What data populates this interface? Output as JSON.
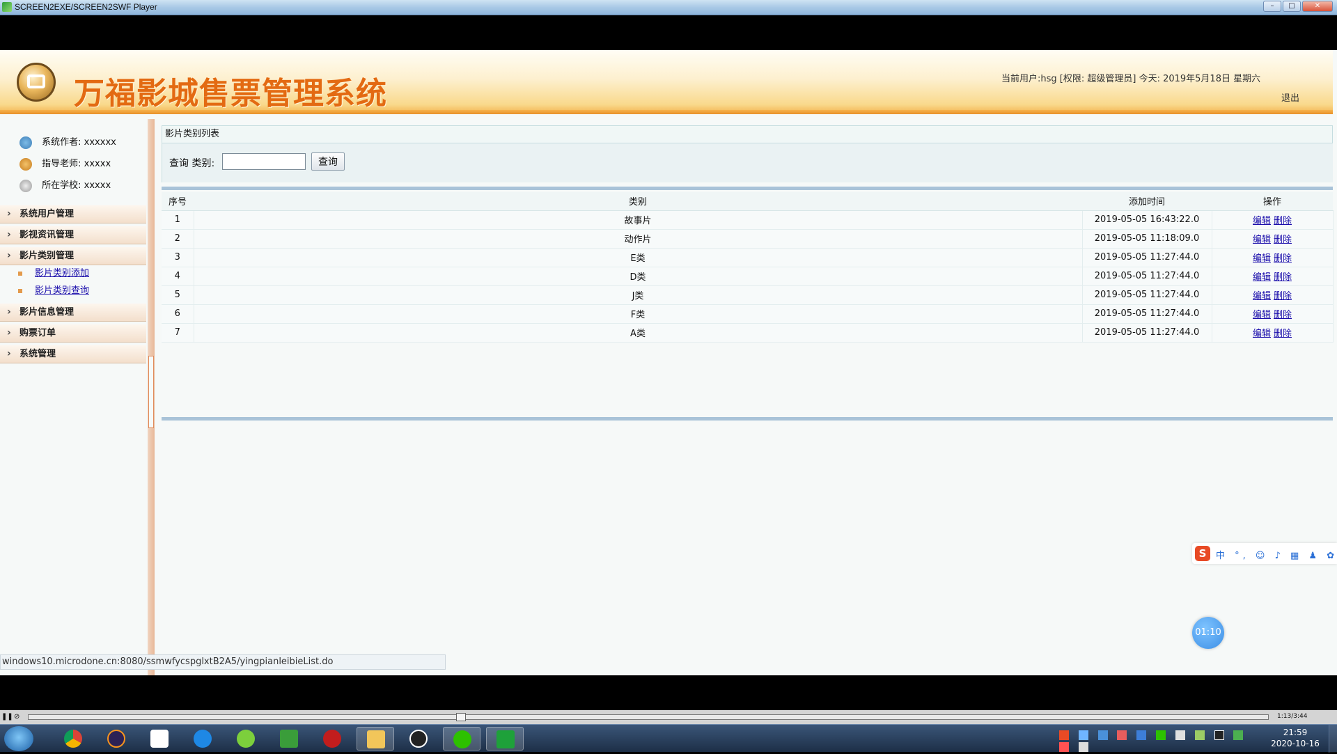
{
  "window": {
    "title": "SCREEN2EXE/SCREEN2SWF Player"
  },
  "header": {
    "system_title": "万福影城售票管理系统",
    "user_info": "当前用户:hsg [权限: 超级管理员] 今天: 2019年5月18日 星期六",
    "logout": "退出"
  },
  "sidebar": {
    "info": [
      {
        "label": "系统作者:",
        "value": "xxxxxx"
      },
      {
        "label": "指导老师:",
        "value": "xxxxx"
      },
      {
        "label": "所在学校:",
        "value": "xxxxx"
      }
    ],
    "menus": [
      "系统用户管理",
      "影视资讯管理",
      "影片类别管理",
      "影片信息管理",
      "购票订单",
      "系统管理"
    ],
    "submenu": [
      "影片类别添加",
      "影片类别查询"
    ]
  },
  "panel": {
    "title": "影片类别列表",
    "search_label": "查询  类别:",
    "search_value": "",
    "search_button": "查询"
  },
  "table": {
    "headers": [
      "序号",
      "类别",
      "添加时间",
      "操作"
    ],
    "edit_label": "编辑",
    "delete_label": "删除",
    "rows": [
      {
        "no": "1",
        "category": "故事片",
        "time": "2019-05-05 16:43:22.0"
      },
      {
        "no": "2",
        "category": "动作片",
        "time": "2019-05-05 11:18:09.0"
      },
      {
        "no": "3",
        "category": "E类",
        "time": "2019-05-05 11:27:44.0"
      },
      {
        "no": "4",
        "category": "D类",
        "time": "2019-05-05 11:27:44.0"
      },
      {
        "no": "5",
        "category": "J类",
        "time": "2019-05-05 11:27:44.0"
      },
      {
        "no": "6",
        "category": "F类",
        "time": "2019-05-05 11:27:44.0"
      },
      {
        "no": "7",
        "category": "A类",
        "time": "2019-05-05 11:27:44.0"
      }
    ]
  },
  "statusbar": {
    "url": "windows10.microdone.cn:8080/ssmwfycspglxtB2A5/yingpianleibieList.do"
  },
  "overlay": {
    "ime_logo": "S",
    "ime_tools": "中 °, ☺ ♪ ▦ ♟ ✿ ▦",
    "timer": "01:10"
  },
  "player": {
    "time": "1:13/3:44"
  },
  "taskbar": {
    "clock_time": "21:59",
    "clock_date": "2020-10-16"
  },
  "colors": {
    "title_orange": "#e36a12",
    "link_blue": "#1a0dab",
    "banner_gold": "#f3b04a"
  }
}
